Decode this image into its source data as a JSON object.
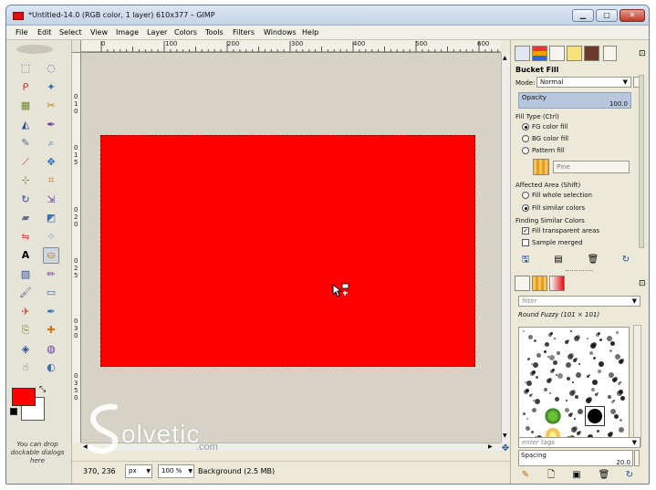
{
  "window": {
    "title": "*Untitled-14.0 (RGB color, 1 layer) 610x377 – GIMP",
    "minimize_label": "▁",
    "maximize_label": "□",
    "close_label": "✕"
  },
  "menubar": {
    "items": [
      "File",
      "Edit",
      "Select",
      "View",
      "Image",
      "Layer",
      "Colors",
      "Tools",
      "Filters",
      "Windows",
      "Help"
    ]
  },
  "ruler": {
    "h_marks": [
      "0",
      "100",
      "200",
      "300",
      "400",
      "500",
      "600"
    ],
    "v_marks": [
      "0",
      "1",
      "0",
      "0",
      "1",
      "5",
      "0",
      "2",
      "0",
      "0",
      "2",
      "5",
      "0",
      "3",
      "0",
      "0",
      "3",
      "5",
      "0"
    ]
  },
  "toolbox": {
    "drop_hint": "You can drop dockable dialogs here",
    "fg_color": "#ff0000",
    "bg_color": "#ffffff",
    "tools": [
      "rect-select",
      "ellipse-select",
      "free-select",
      "fuzzy-select",
      "select-by-color",
      "scissors",
      "foreground-select",
      "paths",
      "color-picker",
      "zoom",
      "measure",
      "move",
      "align",
      "crop",
      "rotate",
      "scale",
      "shear",
      "perspective",
      "flip",
      "cage",
      "text",
      "bucket-fill",
      "blend",
      "pencil",
      "paintbrush",
      "eraser",
      "airbrush",
      "ink",
      "clone",
      "heal",
      "perspective-clone",
      "blur",
      "smudge",
      "dodge-burn"
    ]
  },
  "statusbar": {
    "coords": "370, 236",
    "unit": "px",
    "zoom": "100 %",
    "layer_info": "Background (2.5 MB)"
  },
  "tool_options": {
    "title": "Bucket Fill",
    "mode_label": "Mode:",
    "mode_value": "Normal",
    "opacity_label": "Opacity",
    "opacity_value": "100.0",
    "fill_type_label": "Fill Type  (Ctrl)",
    "fill_fg": "FG color fill",
    "fill_bg": "BG color fill",
    "fill_pattern": "Pattern fill",
    "pattern_name": "Pine",
    "affected_label": "Affected Area  (Shift)",
    "affected_whole": "Fill whole selection",
    "affected_similar": "Fill similar colors",
    "finding_label": "Finding Similar Colors",
    "fill_transparent": "Fill transparent areas",
    "sample_merged": "Sample merged"
  },
  "brushes": {
    "filter_placeholder": "filter",
    "brush_name": "Round Fuzzy (101 × 101)",
    "tags_placeholder": "enter tags",
    "spacing_label": "Spacing",
    "spacing_value": "20.0"
  },
  "watermark": {
    "text": "olvetic",
    "suffix": ".com"
  },
  "colors": {
    "accent": "#ff0000",
    "window_bg": "#ece9d8",
    "canvas_bg": "#d6d3c6"
  }
}
